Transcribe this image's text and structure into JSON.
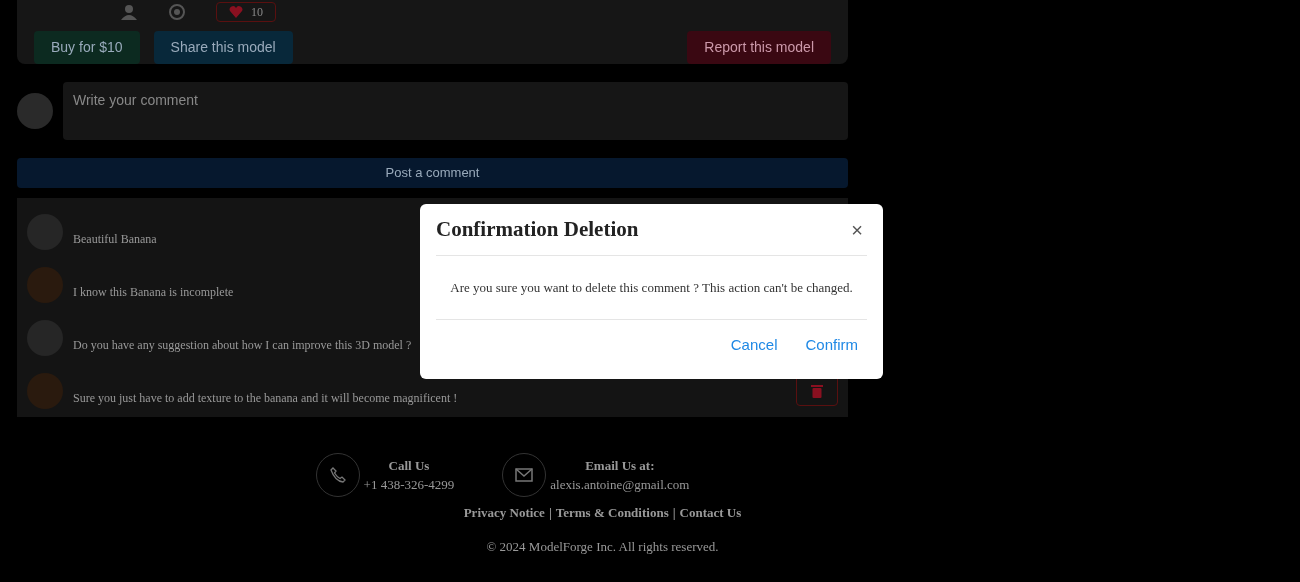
{
  "model_card": {
    "like_count": "10",
    "buttons": [
      {
        "kind": "buy",
        "label": "Buy for $10"
      },
      {
        "kind": "share",
        "label": "Share this model"
      },
      {
        "kind": "report",
        "label": "Report this model"
      }
    ]
  },
  "comment_form": {
    "placeholder": "Write your comment",
    "post_button": "Post a comment"
  },
  "comments": [
    {
      "text": "Beautiful Banana"
    },
    {
      "text": "I know this Banana is incomplete"
    },
    {
      "text": "Do you have any suggestion about how I can improve this 3D model ?"
    },
    {
      "text": "Sure you just have to add texture to the banana and it will become magnificent !",
      "deletable": true
    }
  ],
  "footer": {
    "call_label": "Call Us",
    "phone": "+1 438-326-4299",
    "email_label": "Email Us at:",
    "email": "alexis.antoine@gmail.com",
    "links": [
      "Privacy Notice",
      "Terms & Conditions",
      "Contact Us"
    ],
    "separator": "|",
    "copyright": "© 2024 ModelForge Inc. All rights reserved."
  },
  "dialog": {
    "title": "Confirmation Deletion",
    "close": "×",
    "message": "Are you sure you want to delete this comment ? This action can't be changed.",
    "buttons": [
      "Cancel",
      "Confirm"
    ]
  }
}
